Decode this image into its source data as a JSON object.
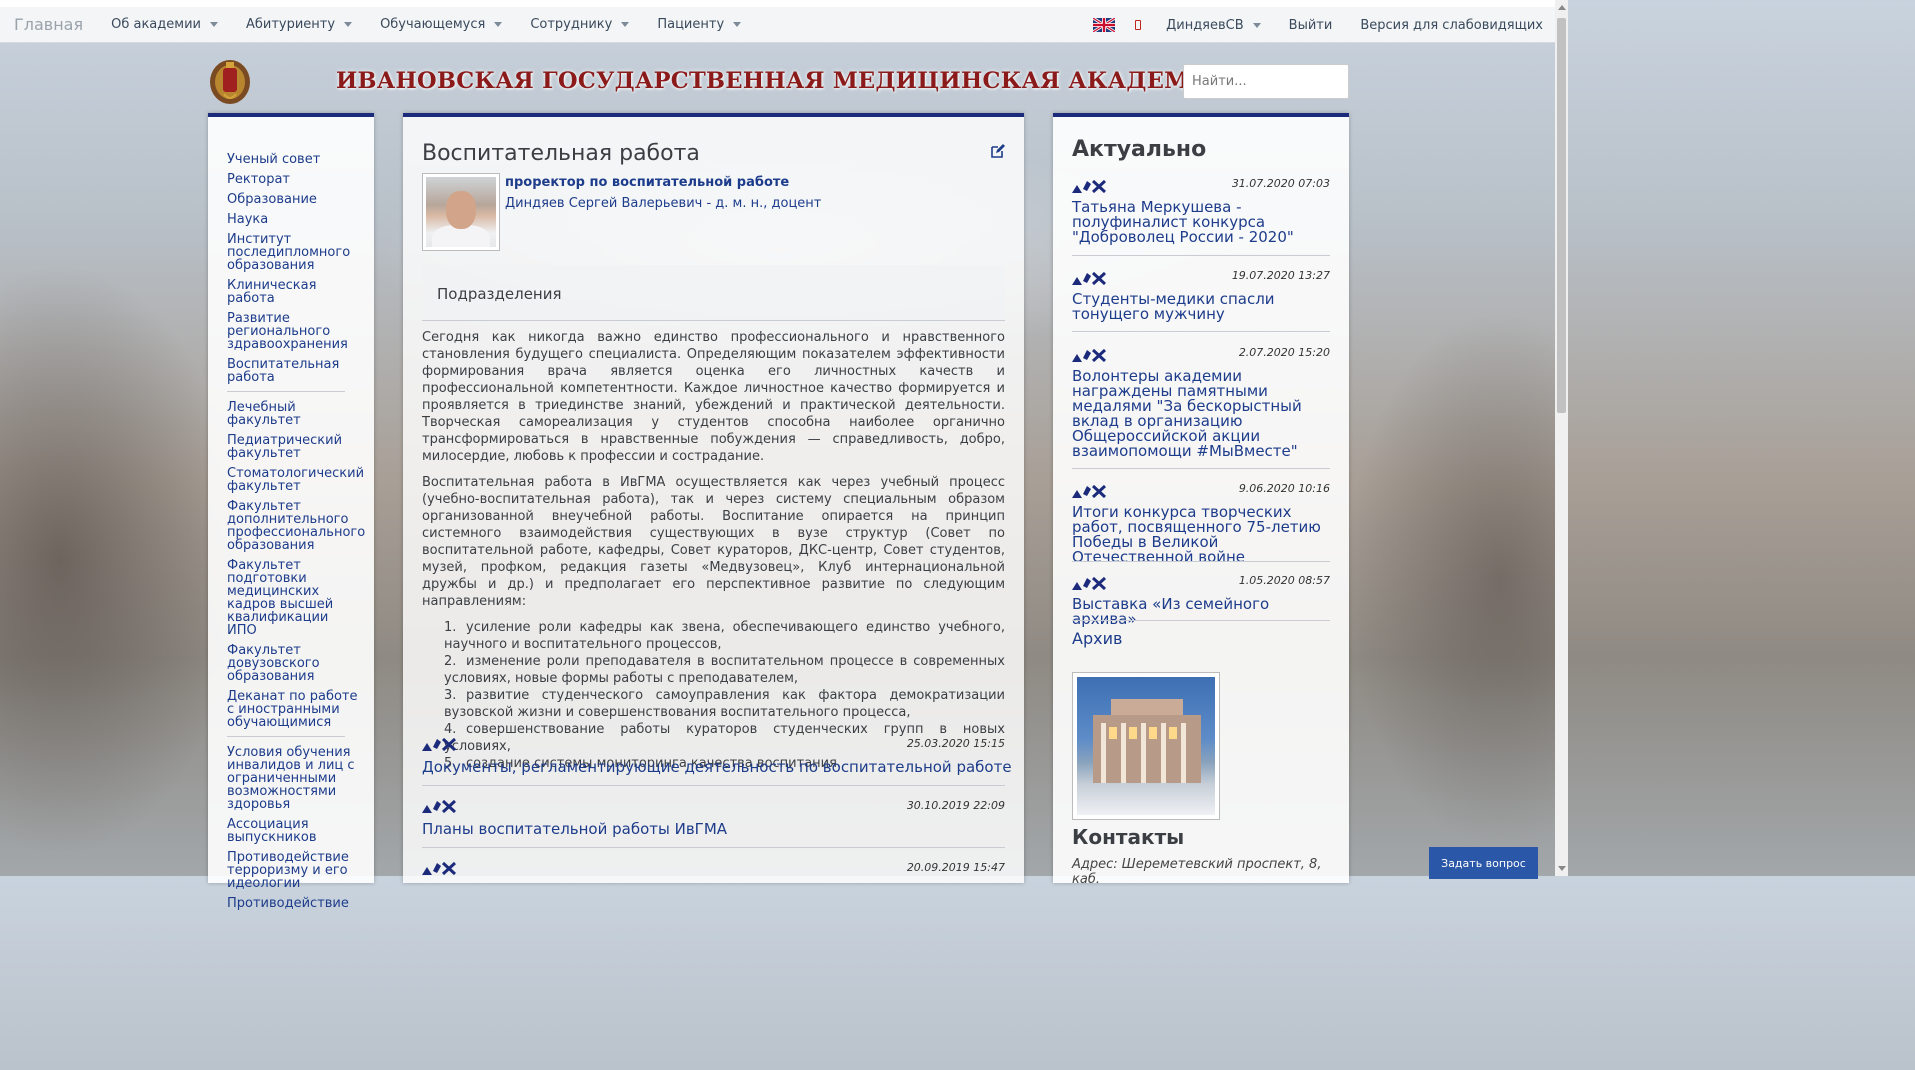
{
  "navbar": {
    "brand": "Главная",
    "items": [
      {
        "label": "Об академии"
      },
      {
        "label": "Абитуриенту"
      },
      {
        "label": "Обучающемуся"
      },
      {
        "label": "Сотруднику"
      },
      {
        "label": "Пациенту"
      }
    ],
    "user": "ДиндяевСВ",
    "logout": "Выйти",
    "accessibility": "Версия для слабовидящих",
    "flag_icon": "uk-flag-icon",
    "phone_icon": "mobile-phone-icon"
  },
  "header": {
    "title": "ИВАНОВСКАЯ ГОСУДАРСТВЕННАЯ МЕДИЦИНСКАЯ АКАДЕМИЯ",
    "emblem_icon": "academy-emblem-icon",
    "title_color": "#8b1a1a"
  },
  "search": {
    "placeholder": "Найти..."
  },
  "left_nav": {
    "group1": [
      "Ученый совет",
      "Ректорат",
      "Образование",
      "Наука",
      "Институт последипломного образования",
      "Клиническая работа",
      "Развитие регионального здравоохранения",
      "Воспитательная работа"
    ],
    "group2": [
      "Лечебный факультет",
      "Педиатрический факультет",
      "Стоматологический факультет",
      "Факультет дополнительного профессионального образования",
      "Факультет подготовки медицинских кадров высшей квалификации ИПО",
      "Факультет довузовского образования",
      "Деканат по работе с иностранными обучающимися"
    ],
    "group3": [
      "Условия обучения инвалидов и лиц с ограниченными возможностями здоровья",
      "Ассоциация выпускников",
      "Противодействие терроризму и его идеологии",
      "Противодействие"
    ]
  },
  "main": {
    "title": "Воспитательная работа",
    "role_title": "проректор по воспитательной работе",
    "role_name": "Диндяев Сергей Валерьевич - д. м. н., доцент",
    "subtab": "Подразделения",
    "paragraph1": "Сегодня как никогда важно единство профессионального и нравственного становления будущего специалиста. Определяющим показателем эффективности формирования врача является оценка его личностных качеств и профессиональной компетентности. Каждое личностное качество формируется и проявляется в триединстве знаний, убеждений и практической деятельности. Творческая самореализация у студентов способна наиболее органично трансформироваться в нравственные побуждения — справедливость, добро, милосердие, любовь к профессии и сострадание.",
    "paragraph2": "Воспитательная работа в ИвГМА осуществляется как через учебный процесс (учебно-воспитательная работа), так и через систему специальным образом организованной внеучебной работы. Воспитание опирается на принцип системного взаимодействия существующих в вузе структур (Совет по воспитательной работе, кафедры, Совет кураторов, ДКС-центр, Совет студентов, музей, профком, редакция газеты «Медвузовец», Клуб интернациональной дружбы и др.) и предполагает его перспективное развитие по следующим направлениям:",
    "list": [
      {
        "num": "1.",
        "text": "усиление роли кафедры как звена, обеспечивающего единство учебного, научного и воспитательного процессов,"
      },
      {
        "num": "2.",
        "text": "изменение роли преподавателя в воспитательном процессе в современных условиях, новые формы работы с преподавателем,"
      },
      {
        "num": "3.",
        "text": "развитие студенческого самоуправления как фактора демократизации вузовской жизни и совершенствования воспитательного процесса,"
      },
      {
        "num": "4.",
        "text": "совершенствование работы кураторов студенческих групп в новых условиях,"
      },
      {
        "num": "5.",
        "text": "создание системы мониторинга качества воспитания."
      }
    ],
    "entries": [
      {
        "date": "25.03.2020 15:15",
        "title": "Документы, регламентирующие деятельность по воспитательной работе"
      },
      {
        "date": "30.10.2019 22:09",
        "title": "Планы воспитательной работы ИвГМА"
      },
      {
        "date": "20.09.2019 15:47",
        "title": ""
      }
    ]
  },
  "right": {
    "title": "Актуально",
    "news": [
      {
        "date": "31.07.2020 07:03",
        "title": "Татьяна Меркушева - полуфиналист конкурса \"Доброволец России - 2020\""
      },
      {
        "date": "19.07.2020 13:27",
        "title": "Студенты-медики спасли тонущего мужчину"
      },
      {
        "date": "2.07.2020 15:20",
        "title": "Волонтеры академии награждены памятными медалями \"За бескорыстный вклад в организацию Общероссийской акции взаимопомощи #МыВместе\""
      },
      {
        "date": "9.06.2020 10:16",
        "title": "Итоги конкурса творческих работ, посвященного 75-летию Победы в Великой Отечественной войне"
      },
      {
        "date": "1.05.2020 08:57",
        "title": "Выставка «Из семейного архива»"
      }
    ],
    "archive": "Архив",
    "contacts_title": "Контакты",
    "address": "Адрес: Шереметевский проспект, 8, каб."
  },
  "ask_button": "Задать вопрос",
  "colors": {
    "accent": "#1b2a7a",
    "link": "#1d3c8b",
    "button": "#2b57a8"
  }
}
